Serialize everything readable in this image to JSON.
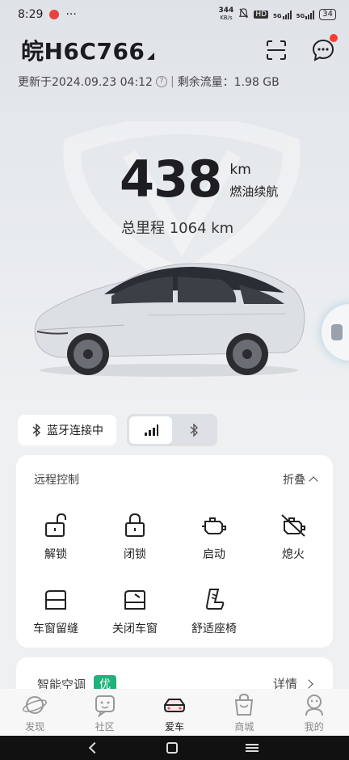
{
  "status_bar": {
    "time": "8:29",
    "network_speed": "344",
    "network_speed_unit": "KB/s",
    "hd_label": "HD",
    "sim1": "5G",
    "sim2": "5G",
    "battery": "34"
  },
  "header": {
    "plate": "皖H6C766",
    "scan_icon": "scan-icon",
    "message_icon": "message-icon"
  },
  "update_line": {
    "updated_at": "更新于2024.09.23 04:12",
    "separator": "|",
    "data_remaining": "剩余流量：1.98 GB"
  },
  "vehicle_status": {
    "range_value": "438",
    "range_unit": "km",
    "range_label": "燃油续航",
    "odometer": "总里程 1064 km"
  },
  "connection": {
    "bluetooth_label": "蓝牙连接中",
    "modes": [
      "cellular-signal-icon",
      "bluetooth-icon"
    ],
    "active_mode": 0
  },
  "remote_control": {
    "title": "远程控制",
    "collapse_label": "折叠",
    "controls": [
      {
        "label": "解锁",
        "icon": "unlock-icon"
      },
      {
        "label": "闭锁",
        "icon": "lock-icon"
      },
      {
        "label": "启动",
        "icon": "engine-start-icon"
      },
      {
        "label": "熄火",
        "icon": "engine-off-icon"
      },
      {
        "label": "车窗留缝",
        "icon": "window-vent-icon"
      },
      {
        "label": "关闭车窗",
        "icon": "window-close-icon"
      },
      {
        "label": "舒适座椅",
        "icon": "seat-icon"
      }
    ]
  },
  "ac_card": {
    "title": "智能空调",
    "badge": "优",
    "detail_label": "详情"
  },
  "tabbar": {
    "tabs": [
      {
        "label": "发现",
        "icon": "planet-icon"
      },
      {
        "label": "社区",
        "icon": "community-icon"
      },
      {
        "label": "爱车",
        "icon": "car-icon"
      },
      {
        "label": "商城",
        "icon": "shopping-bag-icon"
      },
      {
        "label": "我的",
        "icon": "profile-icon"
      }
    ],
    "active_index": 2
  },
  "colors": {
    "accent_green": "#1fb27a",
    "alert_red": "#ff3b30",
    "background": "#e8ebee"
  }
}
